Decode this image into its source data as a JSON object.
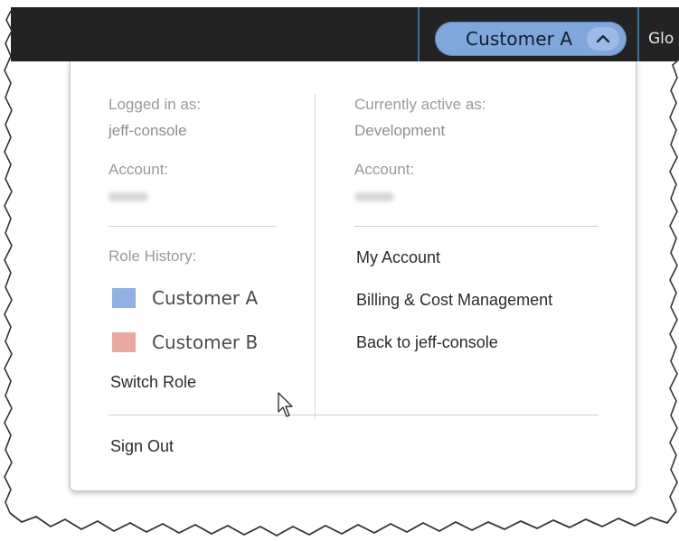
{
  "topbar": {
    "role_pill_label": "Customer A",
    "global_label": "Glo"
  },
  "menu": {
    "logged_in": {
      "label": "Logged in as:",
      "value": "jeff-console",
      "account_label": "Account:",
      "account_value_redacted": true
    },
    "active": {
      "label": "Currently active as:",
      "value": "Development",
      "account_label": "Account:",
      "account_value_redacted": true
    },
    "role_history": {
      "label": "Role History:",
      "items": [
        {
          "label": "Customer A",
          "color": "#8fb1e3"
        },
        {
          "label": "Customer B",
          "color": "#eba8a2"
        }
      ],
      "switch_role_label": "Switch Role"
    },
    "links": [
      {
        "label": "My Account"
      },
      {
        "label": "Billing & Cost Management"
      },
      {
        "label": "Back to jeff-console"
      }
    ],
    "sign_out_label": "Sign Out"
  },
  "colors": {
    "topbar_bg": "#232323",
    "pill_bg": "#7fa7dc"
  },
  "icons": [
    "chevron-up-icon",
    "mouse-pointer-icon"
  ]
}
